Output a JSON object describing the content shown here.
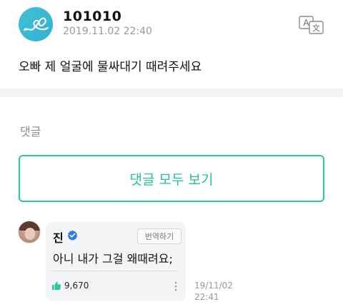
{
  "post": {
    "username": "101010",
    "timestamp": "2019.11.02 22:40",
    "body": "오빠 제 얼굴에 물싸대기 때려주세요",
    "avatar_icon": "heart-scribble-icon",
    "translate_icon": "translate-icon"
  },
  "comments": {
    "heading": "댓글",
    "view_all_label": "댓글 모두 보기",
    "items": [
      {
        "author": "진",
        "verified_icon": "verified-badge-icon",
        "translate_label": "번역하기",
        "text": "아니 내가 그걸 왜때려요;",
        "likes": "9,670",
        "like_icon": "thumbs-up-icon",
        "more_icon": "more-vertical-icon",
        "date": "19/11/02",
        "time": "22:41"
      }
    ]
  },
  "colors": {
    "accent": "#25c199",
    "muted": "#9a9a9a",
    "card_bg": "#f4f5f7",
    "verified": "#2f7de1"
  }
}
